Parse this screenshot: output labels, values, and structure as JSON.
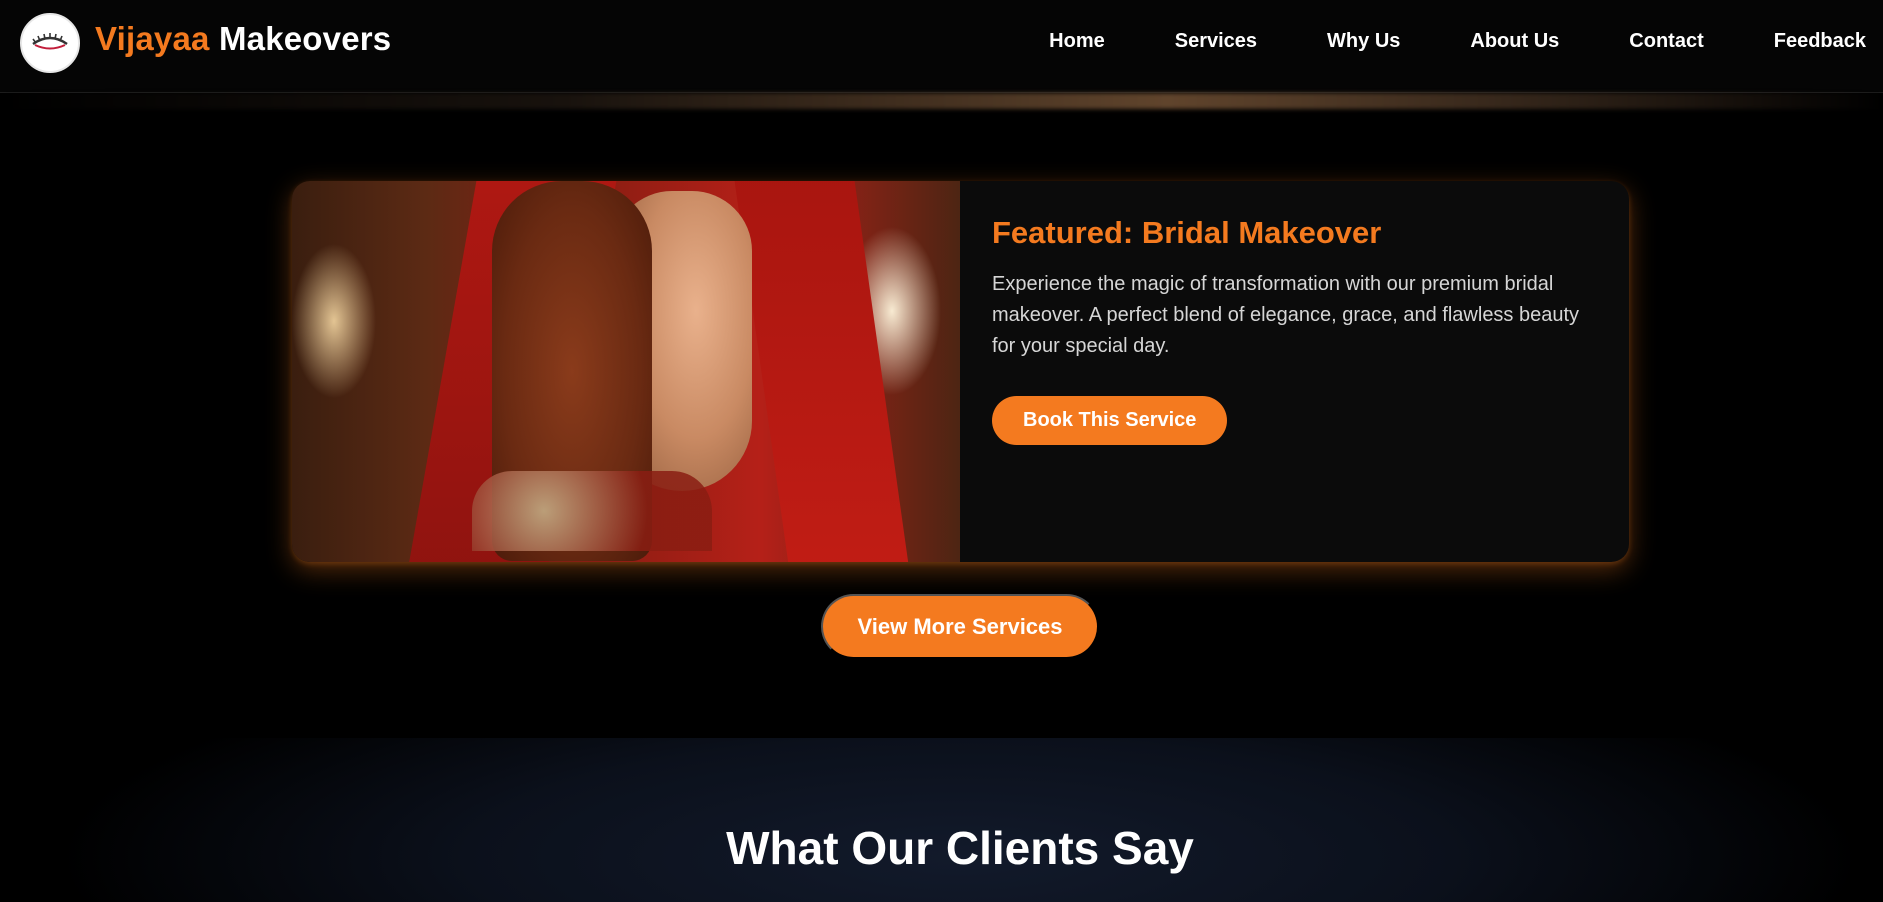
{
  "brand": {
    "name_accent": "Vijayaa",
    "name_rest": "Makeovers",
    "logo_icon": "eye-lash-icon"
  },
  "nav": {
    "items": [
      "Home",
      "Services",
      "Why Us",
      "About Us",
      "Contact",
      "Feedback"
    ]
  },
  "featured": {
    "title": "Featured: Bridal Makeover",
    "description": "Experience the magic of transformation with our premium bridal makeover. A perfect blend of elegance, grace, and flawless beauty for your special day.",
    "book_button": "Book This Service"
  },
  "view_more_label": "View More Services",
  "testimonials": {
    "title": "What Our Clients Say"
  },
  "colors": {
    "accent": "#f47a1f",
    "background": "#000000"
  }
}
